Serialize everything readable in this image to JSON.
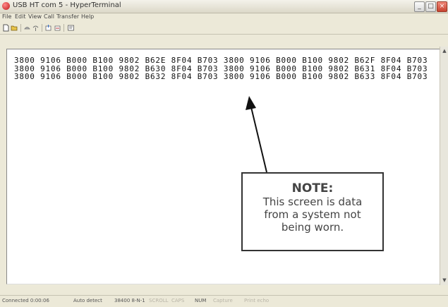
{
  "window": {
    "title": "USB HT com 5 - HyperTerminal"
  },
  "menu": [
    "File",
    "Edit",
    "View",
    "Call",
    "Transfer",
    "Help"
  ],
  "toolbar": [
    "new-icon",
    "open-icon",
    "phone-icon",
    "disconnect-icon",
    "send-icon",
    "receive-icon",
    "properties-icon"
  ],
  "terminal": {
    "lines": [
      "3800 9106 B000 B100 9802 B62E 8F04 B703 3800 9106 B000 B100 9802 B62F 8F04 B703",
      "3800 9106 B000 B100 9802 B630 8F04 B703 3800 9106 B000 B100 9802 B631 8F04 B703",
      "3800 9106 B000 B100 9802 B632 8F04 B703 3800 9106 B000 B100 9802 B633 8F04 B703"
    ]
  },
  "status": {
    "connected": "Connected 0:00:06",
    "detect": "Auto detect",
    "settings": "38400 8-N-1",
    "scroll": "SCROLL",
    "caps": "CAPS",
    "num": "NUM",
    "capture": "Capture",
    "print_echo": "Print echo"
  },
  "note": {
    "title": "NOTE:",
    "lines": [
      "This screen is data",
      "from a system not",
      "being worn."
    ]
  }
}
